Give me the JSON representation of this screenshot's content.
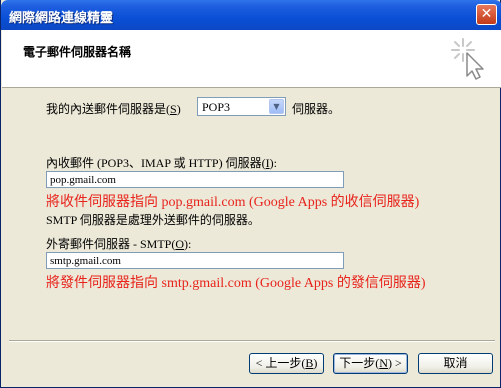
{
  "window": {
    "title": "網際網路連線精靈",
    "close_glyph": "✕"
  },
  "header": {
    "title": "電子郵件伺服器名稱",
    "icon": "wizard-cursor-icon"
  },
  "incoming_type": {
    "label_pre": "我的內送郵件伺服器是(",
    "label_key": "S",
    "label_post": ")",
    "selected": "POP3",
    "suffix": "伺服器。"
  },
  "incoming_server": {
    "label_pre": "內收郵件 (POP3、IMAP 或 HTTP) 伺服器(",
    "label_key": "I",
    "label_post": "):",
    "value": "pop.gmail.com",
    "note": "將收件伺服器指向 pop.gmail.com (Google Apps 的收信伺服器)"
  },
  "smtp_info": "SMTP 伺服器是處理外送郵件的伺服器。",
  "outgoing_server": {
    "label_pre": "外寄郵件伺服器 - SMTP(",
    "label_key": "O",
    "label_post": "):",
    "value": "smtp.gmail.com",
    "note": "將發件伺服器指向 smtp.gmail.com (Google Apps 的發信伺服器)"
  },
  "buttons": {
    "back": {
      "pre": "< 上一步(",
      "key": "B",
      "post": ")"
    },
    "next": {
      "pre": "下一步(",
      "key": "N",
      "post": ") >"
    },
    "cancel": "取消"
  },
  "colors": {
    "title_bar": "#0a4fd6",
    "note_red": "#e8231c",
    "dialog_bg": "#ece9d8"
  }
}
